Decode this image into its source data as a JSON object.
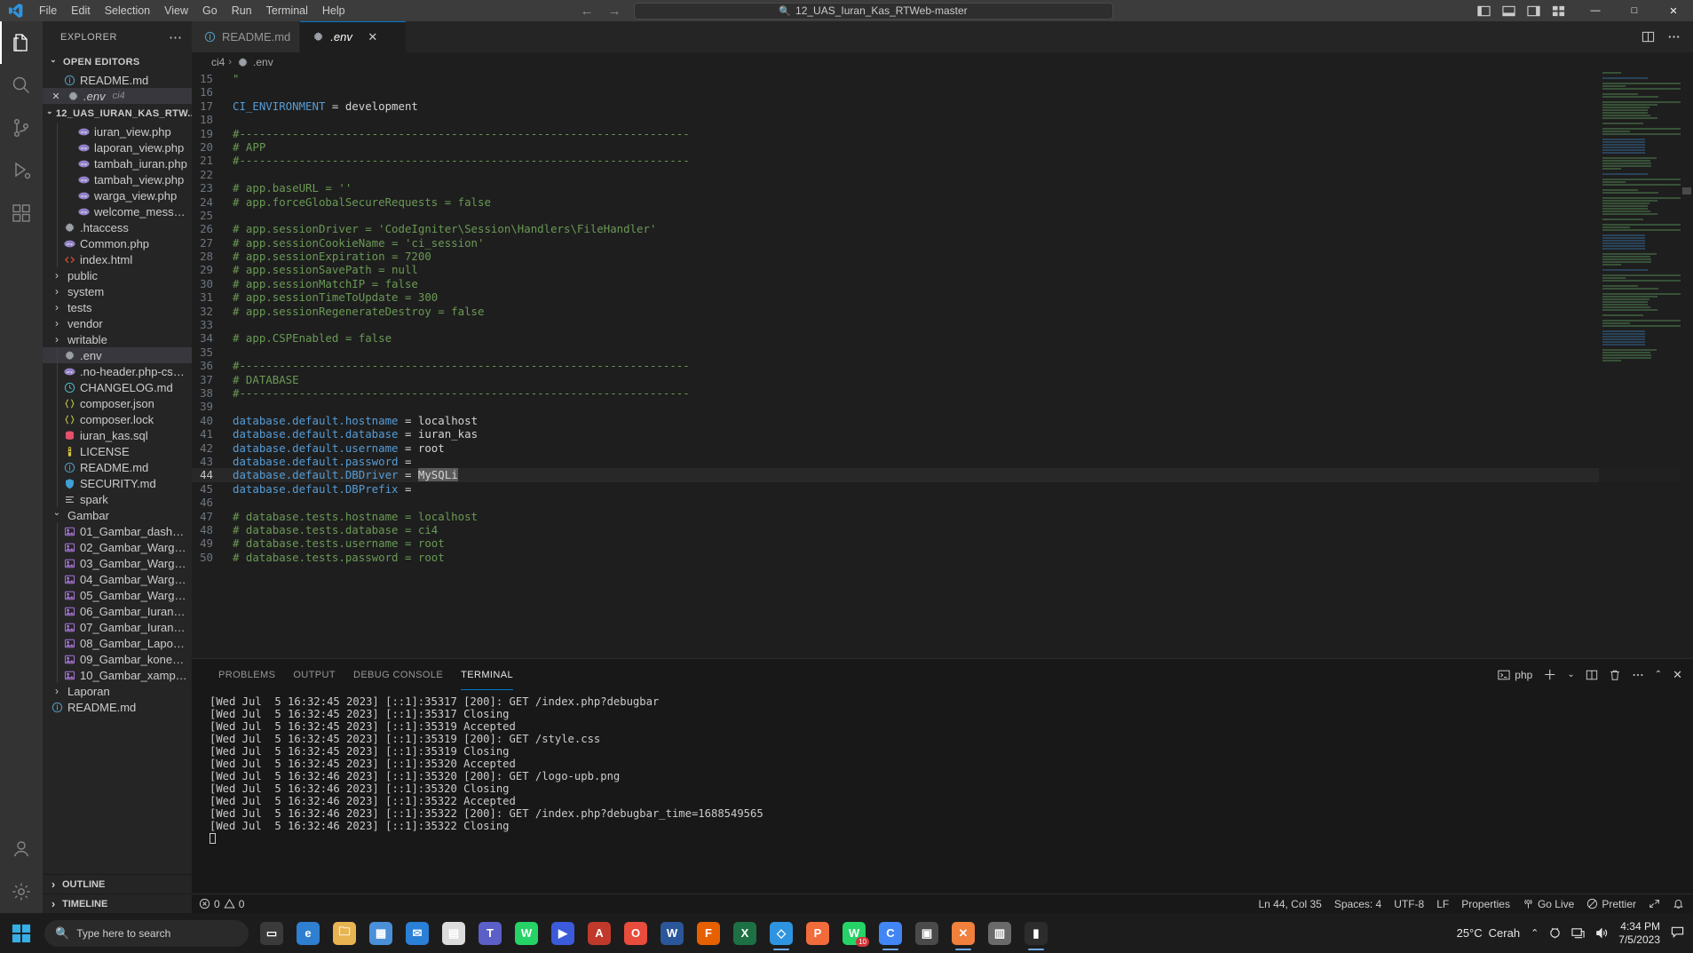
{
  "titlebar": {
    "menus": [
      "File",
      "Edit",
      "Selection",
      "View",
      "Go",
      "Run",
      "Terminal",
      "Help"
    ],
    "quick_input": "12_UAS_Iuran_Kas_RTWeb-master",
    "quick_input_icon": "search-icon",
    "back_arrow": "←",
    "forward_arrow": "→",
    "minimize": "—",
    "maximize": "□",
    "close": "✕"
  },
  "activitybar": {
    "items": [
      {
        "name": "explorer",
        "icon": "files-icon",
        "active": true
      },
      {
        "name": "search",
        "icon": "search-icon",
        "active": false
      },
      {
        "name": "source-control",
        "icon": "source-control-icon",
        "active": false
      },
      {
        "name": "run-debug",
        "icon": "run-debug-icon",
        "active": false
      },
      {
        "name": "extensions",
        "icon": "extensions-icon",
        "active": false
      }
    ],
    "bottom": [
      {
        "name": "accounts",
        "icon": "account-icon"
      },
      {
        "name": "settings",
        "icon": "gear-icon"
      }
    ]
  },
  "sidebar": {
    "title": "EXPLORER",
    "more_actions": "⋯",
    "open_editors": {
      "label": "OPEN EDITORS",
      "items": [
        {
          "label": "README.md",
          "icon": "info-icon",
          "sub": "",
          "active": false
        },
        {
          "label": ".env",
          "icon": "gear-icon",
          "sub": "ci4",
          "active": true
        }
      ]
    },
    "project": {
      "label": "12_UAS_IURAN_KAS_RTW...",
      "items": [
        {
          "label": "iuran_view.php",
          "icon": "php-icon",
          "indent": 3,
          "type": "file"
        },
        {
          "label": "laporan_view.php",
          "icon": "php-icon",
          "indent": 3,
          "type": "file"
        },
        {
          "label": "tambah_iuran.php",
          "icon": "php-icon",
          "indent": 3,
          "type": "file"
        },
        {
          "label": "tambah_view.php",
          "icon": "php-icon",
          "indent": 3,
          "type": "file"
        },
        {
          "label": "warga_view.php",
          "icon": "php-icon",
          "indent": 3,
          "type": "file"
        },
        {
          "label": "welcome_messag...",
          "icon": "php-icon",
          "indent": 3,
          "type": "file"
        },
        {
          "label": ".htaccess",
          "icon": "gear-icon",
          "indent": 2,
          "type": "file"
        },
        {
          "label": "Common.php",
          "icon": "php-icon",
          "indent": 2,
          "type": "file"
        },
        {
          "label": "index.html",
          "icon": "html-icon",
          "indent": 2,
          "type": "file"
        },
        {
          "label": "public",
          "icon": "chevron-right-icon",
          "indent": 1,
          "type": "folder"
        },
        {
          "label": "system",
          "icon": "chevron-right-icon",
          "indent": 1,
          "type": "folder"
        },
        {
          "label": "tests",
          "icon": "chevron-right-icon",
          "indent": 1,
          "type": "folder"
        },
        {
          "label": "vendor",
          "icon": "chevron-right-icon",
          "indent": 1,
          "type": "folder"
        },
        {
          "label": "writable",
          "icon": "chevron-right-icon",
          "indent": 1,
          "type": "folder"
        },
        {
          "label": ".env",
          "icon": "gear-icon",
          "indent": 2,
          "type": "file",
          "selected": true
        },
        {
          "label": ".no-header.php-cs-fi...",
          "icon": "php-icon",
          "indent": 2,
          "type": "file"
        },
        {
          "label": "CHANGELOG.md",
          "icon": "clock-icon",
          "indent": 2,
          "type": "file"
        },
        {
          "label": "composer.json",
          "icon": "json-icon",
          "indent": 2,
          "type": "file"
        },
        {
          "label": "composer.lock",
          "icon": "json-icon",
          "indent": 2,
          "type": "file"
        },
        {
          "label": "iuran_kas.sql",
          "icon": "database-icon",
          "indent": 2,
          "type": "file"
        },
        {
          "label": "LICENSE",
          "icon": "license-icon",
          "indent": 2,
          "type": "file"
        },
        {
          "label": "README.md",
          "icon": "info-icon",
          "indent": 2,
          "type": "file"
        },
        {
          "label": "SECURITY.md",
          "icon": "shield-down-icon",
          "indent": 2,
          "type": "file"
        },
        {
          "label": "spark",
          "icon": "list-icon",
          "indent": 2,
          "type": "file"
        },
        {
          "label": "Gambar",
          "icon": "chevron-down-icon",
          "indent": 1,
          "type": "folder-open"
        },
        {
          "label": "01_Gambar_dashbo...",
          "icon": "image-icon",
          "indent": 2,
          "type": "file"
        },
        {
          "label": "02_Gambar_Warga.j...",
          "icon": "image-icon",
          "indent": 2,
          "type": "file"
        },
        {
          "label": "03_Gambar_Warga_...",
          "icon": "image-icon",
          "indent": 2,
          "type": "file"
        },
        {
          "label": "04_Gambar_Warga_...",
          "icon": "image-icon",
          "indent": 2,
          "type": "file"
        },
        {
          "label": "05_Gambar_Warga_...",
          "icon": "image-icon",
          "indent": 2,
          "type": "file"
        },
        {
          "label": "06_Gambar_IuranKa...",
          "icon": "image-icon",
          "indent": 2,
          "type": "file"
        },
        {
          "label": "07_Gambar_Iuran_ta...",
          "icon": "image-icon",
          "indent": 2,
          "type": "file"
        },
        {
          "label": "08_Gambar_Laporan...",
          "icon": "image-icon",
          "indent": 2,
          "type": "file"
        },
        {
          "label": "09_Gambar_koneksi....",
          "icon": "image-icon",
          "indent": 2,
          "type": "file"
        },
        {
          "label": "10_Gambar_xampp.j...",
          "icon": "image-icon",
          "indent": 2,
          "type": "file"
        },
        {
          "label": "Laporan",
          "icon": "chevron-right-icon",
          "indent": 1,
          "type": "folder"
        },
        {
          "label": "README.md",
          "icon": "info-icon",
          "indent": 1,
          "type": "file"
        }
      ]
    },
    "collapsed_sections": [
      "OUTLINE",
      "TIMELINE"
    ]
  },
  "editor": {
    "tabs": [
      {
        "label": "README.md",
        "icon": "info-icon",
        "active": false,
        "close": ""
      },
      {
        "label": ".env",
        "icon": "gear-icon",
        "active": true,
        "close": "✕"
      }
    ],
    "tab_actions": [
      "split-editor-icon",
      "more-actions-icon"
    ],
    "breadcrumb": [
      "ci4",
      ".env"
    ],
    "breadcrumb_sep": "›",
    "breadcrumb_icon": "gear-icon",
    "selection_text": "MySQLi",
    "current_line": 44,
    "first_visible_line": 15,
    "lines": [
      {
        "n": 15,
        "text": "\"",
        "type": "comment",
        "partial": true
      },
      {
        "n": 16,
        "text": "",
        "type": "blank"
      },
      {
        "n": 17,
        "text": "CI_ENVIRONMENT = development",
        "type": "assign_active"
      },
      {
        "n": 18,
        "text": "",
        "type": "blank"
      },
      {
        "n": 19,
        "text": "#--------------------------------------------------------------------",
        "type": "comment"
      },
      {
        "n": 20,
        "text": "# APP",
        "type": "comment"
      },
      {
        "n": 21,
        "text": "#--------------------------------------------------------------------",
        "type": "comment"
      },
      {
        "n": 22,
        "text": "",
        "type": "blank"
      },
      {
        "n": 23,
        "text": "# app.baseURL = ''",
        "type": "comment"
      },
      {
        "n": 24,
        "text": "# app.forceGlobalSecureRequests = false",
        "type": "comment"
      },
      {
        "n": 25,
        "text": "",
        "type": "blank"
      },
      {
        "n": 26,
        "text": "# app.sessionDriver = 'CodeIgniter\\Session\\Handlers\\FileHandler'",
        "type": "comment"
      },
      {
        "n": 27,
        "text": "# app.sessionCookieName = 'ci_session'",
        "type": "comment"
      },
      {
        "n": 28,
        "text": "# app.sessionExpiration = 7200",
        "type": "comment"
      },
      {
        "n": 29,
        "text": "# app.sessionSavePath = null",
        "type": "comment"
      },
      {
        "n": 30,
        "text": "# app.sessionMatchIP = false",
        "type": "comment"
      },
      {
        "n": 31,
        "text": "# app.sessionTimeToUpdate = 300",
        "type": "comment"
      },
      {
        "n": 32,
        "text": "# app.sessionRegenerateDestroy = false",
        "type": "comment"
      },
      {
        "n": 33,
        "text": "",
        "type": "blank"
      },
      {
        "n": 34,
        "text": "# app.CSPEnabled = false",
        "type": "comment"
      },
      {
        "n": 35,
        "text": "",
        "type": "blank"
      },
      {
        "n": 36,
        "text": "#--------------------------------------------------------------------",
        "type": "comment"
      },
      {
        "n": 37,
        "text": "# DATABASE",
        "type": "comment"
      },
      {
        "n": 38,
        "text": "#--------------------------------------------------------------------",
        "type": "comment"
      },
      {
        "n": 39,
        "text": "",
        "type": "blank"
      },
      {
        "n": 40,
        "key": "database.default.hostname",
        "value": "localhost",
        "type": "assign"
      },
      {
        "n": 41,
        "key": "database.default.database",
        "value": "iuran_kas",
        "type": "assign"
      },
      {
        "n": 42,
        "key": "database.default.username",
        "value": "root",
        "type": "assign"
      },
      {
        "n": 43,
        "key": "database.default.password",
        "value": "",
        "type": "assign"
      },
      {
        "n": 44,
        "key": "database.default.DBDriver",
        "value": "MySQLi",
        "type": "assign_selected"
      },
      {
        "n": 45,
        "key": "database.default.DBPrefix",
        "value": "",
        "type": "assign"
      },
      {
        "n": 46,
        "text": "",
        "type": "blank"
      },
      {
        "n": 47,
        "text": "# database.tests.hostname = localhost",
        "type": "comment"
      },
      {
        "n": 48,
        "text": "# database.tests.database = ci4",
        "type": "comment"
      },
      {
        "n": 49,
        "text": "# database.tests.username = root",
        "type": "comment"
      },
      {
        "n": 50,
        "text": "# database.tests.password = root",
        "type": "comment"
      }
    ]
  },
  "panel": {
    "tabs": [
      "PROBLEMS",
      "OUTPUT",
      "DEBUG CONSOLE",
      "TERMINAL"
    ],
    "active_tab": "TERMINAL",
    "terminal_type": "php",
    "actions": [
      "split-terminal-icon",
      "new-terminal-icon",
      "kill-terminal-icon",
      "more-actions-icon",
      "maximize-panel-icon",
      "close-panel-icon"
    ],
    "terminal_lines": [
      "[Wed Jul  5 16:32:45 2023] [::1]:35317 [200]: GET /index.php?debugbar",
      "[Wed Jul  5 16:32:45 2023] [::1]:35317 Closing",
      "[Wed Jul  5 16:32:45 2023] [::1]:35319 Accepted",
      "[Wed Jul  5 16:32:45 2023] [::1]:35319 [200]: GET /style.css",
      "[Wed Jul  5 16:32:45 2023] [::1]:35319 Closing",
      "[Wed Jul  5 16:32:45 2023] [::1]:35320 Accepted",
      "[Wed Jul  5 16:32:46 2023] [::1]:35320 [200]: GET /logo-upb.png",
      "[Wed Jul  5 16:32:46 2023] [::1]:35320 Closing",
      "[Wed Jul  5 16:32:46 2023] [::1]:35322 Accepted",
      "[Wed Jul  5 16:32:46 2023] [::1]:35322 [200]: GET /index.php?debugbar_time=1688549565",
      "[Wed Jul  5 16:32:46 2023] [::1]:35322 Closing"
    ]
  },
  "statusbar": {
    "errors": "0",
    "warnings": "0",
    "position": "Ln 44, Col 35",
    "spaces": "Spaces: 4",
    "encoding": "UTF-8",
    "eol": "LF",
    "language": "Properties",
    "golive": "Go Live",
    "prettier": "Prettier",
    "remote_icon": "remote-icon",
    "bell_icon": "bell-icon"
  },
  "taskbar": {
    "search_placeholder": "Type here to search",
    "search_icon": "search-icon",
    "weather_temp": "25°C",
    "weather_desc": "Cerah",
    "time": "4:34 PM",
    "date": "7/5/2023",
    "whatsapp_badge": "10",
    "apps": [
      {
        "name": "task-view",
        "glyph": "▭"
      },
      {
        "name": "edge",
        "glyph": "e"
      },
      {
        "name": "file-explorer",
        "glyph": "🗀"
      },
      {
        "name": "store",
        "glyph": "▦"
      },
      {
        "name": "mail",
        "glyph": "✉"
      },
      {
        "name": "notepad",
        "glyph": "▤"
      },
      {
        "name": "teams",
        "glyph": "T"
      },
      {
        "name": "whatsapp",
        "glyph": "W"
      },
      {
        "name": "movies",
        "glyph": "▶"
      },
      {
        "name": "acrobat",
        "glyph": "A"
      },
      {
        "name": "opera",
        "glyph": "O"
      },
      {
        "name": "word",
        "glyph": "W"
      },
      {
        "name": "firefox",
        "glyph": "F"
      },
      {
        "name": "excel",
        "glyph": "X"
      },
      {
        "name": "vscode",
        "glyph": "◇"
      },
      {
        "name": "postman",
        "glyph": "P"
      },
      {
        "name": "whatsapp-desktop",
        "glyph": "W"
      },
      {
        "name": "chrome",
        "glyph": "C"
      },
      {
        "name": "app-19",
        "glyph": "▣"
      },
      {
        "name": "xampp",
        "glyph": "✕"
      },
      {
        "name": "app-21",
        "glyph": "▥"
      },
      {
        "name": "terminal",
        "glyph": "▮"
      }
    ]
  }
}
